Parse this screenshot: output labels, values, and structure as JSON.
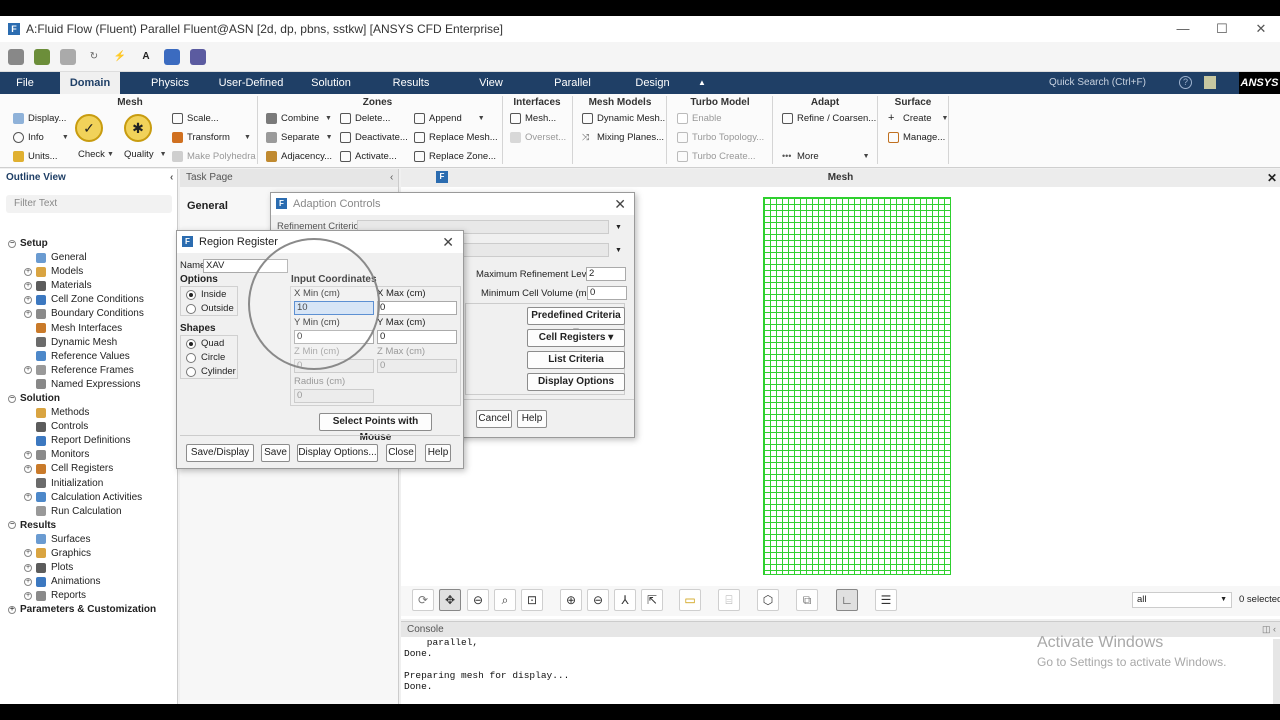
{
  "window": {
    "title": "A:Fluid Flow (Fluent) Parallel Fluent@ASN  [2d, dp, pbns, sstkw] [ANSYS CFD Enterprise]",
    "app_icon": "F"
  },
  "menubar": {
    "items": [
      "File",
      "Domain",
      "Physics",
      "User-Defined",
      "Solution",
      "Results",
      "View",
      "Parallel",
      "Design"
    ],
    "collapse": "▲",
    "search_placeholder": "Quick Search (Ctrl+F)",
    "brand": "ANSYS"
  },
  "ribbon": {
    "mesh": {
      "title": "Mesh",
      "display": "Display...",
      "info": "Info",
      "units": "Units...",
      "check": "Check",
      "quality": "Quality",
      "scale": "Scale...",
      "transform": "Transform",
      "make_polyhedra": "Make Polyhedra"
    },
    "zones": {
      "title": "Zones",
      "combine": "Combine",
      "separate": "Separate",
      "adjacency": "Adjacency...",
      "delete": "Delete...",
      "deactivate": "Deactivate...",
      "activate": "Activate...",
      "append": "Append",
      "replace_mesh": "Replace Mesh...",
      "replace_zone": "Replace Zone..."
    },
    "interfaces": {
      "title": "Interfaces",
      "mesh": "Mesh...",
      "overset": "Overset..."
    },
    "mesh_models": {
      "title": "Mesh Models",
      "dynamic_mesh": "Dynamic Mesh...",
      "mixing_planes": "Mixing Planes..."
    },
    "turbo_model": {
      "title": "Turbo Model",
      "enable": "Enable",
      "turbo_topology": "Turbo Topology...",
      "turbo_create": "Turbo Create..."
    },
    "adapt": {
      "title": "Adapt",
      "refine": "Refine / Coarsen...",
      "more": "More"
    },
    "surface": {
      "title": "Surface",
      "create": "Create",
      "manage": "Manage..."
    }
  },
  "outline": {
    "title": "Outline View",
    "filter_placeholder": "Filter Text",
    "items": [
      {
        "label": "Setup",
        "bold": true,
        "expand": "−",
        "icon": ""
      },
      {
        "label": "General",
        "icon": "general-icon"
      },
      {
        "label": "Models",
        "expand": "+",
        "icon": "models-icon"
      },
      {
        "label": "Materials",
        "expand": "+",
        "icon": "materials-icon"
      },
      {
        "label": "Cell Zone Conditions",
        "expand": "+",
        "icon": "cell-zone-icon"
      },
      {
        "label": "Boundary Conditions",
        "expand": "+",
        "icon": "boundary-icon"
      },
      {
        "label": "Mesh Interfaces",
        "icon": "mesh-interfaces-icon"
      },
      {
        "label": "Dynamic Mesh",
        "icon": "dynamic-mesh-icon"
      },
      {
        "label": "Reference Values",
        "icon": "reference-values-icon"
      },
      {
        "label": "Reference Frames",
        "expand": "+",
        "icon": "reference-frames-icon"
      },
      {
        "label": "Named Expressions",
        "icon": "named-expressions-icon"
      },
      {
        "label": "Solution",
        "bold": true,
        "expand": "−",
        "icon": ""
      },
      {
        "label": "Methods",
        "icon": "methods-icon"
      },
      {
        "label": "Controls",
        "icon": "controls-icon"
      },
      {
        "label": "Report Definitions",
        "icon": "report-definitions-icon"
      },
      {
        "label": "Monitors",
        "expand": "+",
        "icon": "monitors-icon"
      },
      {
        "label": "Cell Registers",
        "expand": "+",
        "icon": "cell-registers-icon"
      },
      {
        "label": "Initialization",
        "icon": "initialization-icon"
      },
      {
        "label": "Calculation Activities",
        "expand": "+",
        "icon": "calculation-activities-icon"
      },
      {
        "label": "Run Calculation",
        "icon": "run-calculation-icon"
      },
      {
        "label": "Results",
        "bold": true,
        "expand": "−",
        "icon": ""
      },
      {
        "label": "Surfaces",
        "icon": "surfaces-icon"
      },
      {
        "label": "Graphics",
        "expand": "+",
        "icon": "graphics-icon"
      },
      {
        "label": "Plots",
        "expand": "+",
        "icon": "plots-icon"
      },
      {
        "label": "Animations",
        "expand": "+",
        "icon": "animations-icon"
      },
      {
        "label": "Reports",
        "expand": "+",
        "icon": "reports-icon"
      },
      {
        "label": "Parameters & Customization",
        "bold": true,
        "expand": "+",
        "icon": ""
      }
    ]
  },
  "task_page": {
    "title": "Task Page",
    "section": "General",
    "partial": "Mesh"
  },
  "graphics": {
    "title": "Mesh",
    "selection_filter": "all",
    "selected_count": "0 selected"
  },
  "console": {
    "title": "Console",
    "lines": [
      "    parallel,",
      "Done.",
      "",
      "Preparing mesh for display...",
      "Done."
    ]
  },
  "watermark": {
    "line1": "Activate Windows",
    "line2": "Go to Settings to activate Windows."
  },
  "adaption_controls": {
    "title": "Adaption Controls",
    "partial_label": "Refinement Criterion",
    "max_refinement_level_label": "Maximum Refinement Level",
    "max_refinement_level": "2",
    "min_cell_volume_label": "Minimum Cell Volume (m3)",
    "min_cell_volume": "0",
    "predefined_criteria": "Predefined Criteria",
    "cell_registers": "Cell Registers",
    "list_criteria": "List Criteria",
    "display_options": "Display Options",
    "cancel": "Cancel",
    "help": "Help"
  },
  "region_register": {
    "title": "Region Register",
    "name_label": "Name",
    "name_value": "XAV",
    "options_label": "Options",
    "inside": "Inside",
    "outside": "Outside",
    "shapes_label": "Shapes",
    "quad": "Quad",
    "circle": "Circle",
    "cylinder": "Cylinder",
    "input_coords_label": "Input Coordinates",
    "xmin_label": "X Min (cm)",
    "xmin": "10",
    "xmax_label": "X Max (cm)",
    "xmax": "0",
    "ymin_label": "Y Min (cm)",
    "ymin": "0",
    "ymax_label": "Y Max (cm)",
    "ymax": "0",
    "zmin_label": "Z Min (cm)",
    "zmin": "0",
    "zmax_label": "Z Max (cm)",
    "zmax": "0",
    "radius_label": "Radius (cm)",
    "radius": "0",
    "select_points": "Select Points with Mouse",
    "save_display": "Save/Display",
    "save": "Save",
    "display_options": "Display Options...",
    "close": "Close",
    "help": "Help"
  },
  "colors": {
    "menubar": "#1f3f66",
    "mesh_lines": "#2fd02f",
    "ansys_black": "#000000",
    "icon_blue": "#2b6cb0"
  }
}
